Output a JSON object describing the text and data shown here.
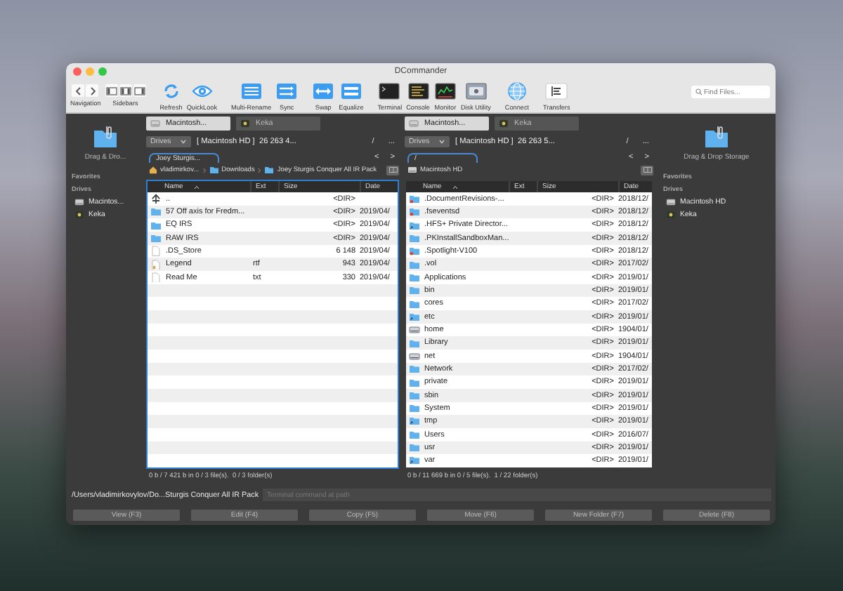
{
  "window": {
    "title": "DCommander"
  },
  "toolbar": [
    [
      {
        "kind": "segmented-nav",
        "label": "Navigation"
      },
      {
        "kind": "segmented-sidebars",
        "label": "Sidebars"
      }
    ],
    [
      {
        "kind": "refresh",
        "label": "Refresh"
      },
      {
        "kind": "quicklook",
        "label": "QuickLook"
      }
    ],
    [
      {
        "kind": "multi-rename",
        "label": "Multi-Rename"
      },
      {
        "kind": "sync",
        "label": "Sync"
      }
    ],
    [
      {
        "kind": "swap",
        "label": "Swap"
      },
      {
        "kind": "equalize",
        "label": "Equalize"
      }
    ],
    [
      {
        "kind": "terminal",
        "label": "Terminal"
      },
      {
        "kind": "console",
        "label": "Console"
      },
      {
        "kind": "monitor",
        "label": "Monitor"
      },
      {
        "kind": "disk-utility",
        "label": "Disk Utility"
      }
    ],
    [
      {
        "kind": "connect",
        "label": "Connect"
      }
    ],
    [
      {
        "kind": "transfers",
        "label": "Transfers"
      }
    ]
  ],
  "search": {
    "placeholder": "Find Files..."
  },
  "sidebars": [
    {
      "drop_label": "Drag & Dro...",
      "favorites_label": "Favorites",
      "drives_label": "Drives",
      "drives": [
        {
          "name": "Macintos...",
          "kind": "hd"
        },
        {
          "name": "Keka",
          "kind": "app"
        }
      ]
    },
    {
      "drop_label": "Drag & Drop Storage",
      "favorites_label": "Favorites",
      "drives_label": "Drives",
      "drives": [
        {
          "name": "Macintosh HD",
          "kind": "hd"
        },
        {
          "name": "Keka",
          "kind": "app"
        }
      ]
    }
  ],
  "panels": [
    {
      "active": true,
      "drive_tabs": [
        {
          "label": "Macintosh...",
          "kind": "hd",
          "selected": true
        },
        {
          "label": "Keka",
          "kind": "app",
          "selected": false
        }
      ],
      "drive_menu": "Drives",
      "drive_info": "[ Macintosh HD ]  26 263 4...",
      "root": "/",
      "more": "...",
      "path_tabs": [
        {
          "label": "Joey Sturgis...",
          "selected": true
        }
      ],
      "back": "<",
      "forward": ">",
      "breadcrumb": [
        {
          "kind": "home",
          "label": "vladimirkov..."
        },
        {
          "kind": "folder",
          "label": "Downloads"
        },
        {
          "kind": "folder",
          "label": "Joey Sturgis Conquer All IR Pack"
        }
      ],
      "columns": [
        "Name",
        "Ext",
        "Size",
        "Date"
      ],
      "rows": [
        {
          "kind": "up",
          "name": "..",
          "size": "<DIR>"
        },
        {
          "kind": "folder",
          "name": "57 Off axis for Fredm...",
          "size": "<DIR>",
          "date": "2019/04/"
        },
        {
          "kind": "folder",
          "name": "EQ IRS",
          "size": "<DIR>",
          "date": "2019/04/"
        },
        {
          "kind": "folder",
          "name": "RAW IRS",
          "size": "<DIR>",
          "date": "2019/04/"
        },
        {
          "kind": "file",
          "name": ".DS_Store",
          "size": "6 148",
          "date": "2019/04/"
        },
        {
          "kind": "doc",
          "name": "Legend",
          "ext": "rtf",
          "size": "943",
          "date": "2019/04/"
        },
        {
          "kind": "file",
          "name": "Read Me",
          "ext": "txt",
          "size": "330",
          "date": "2019/04/"
        }
      ],
      "status": "0 b / 7 421 b in 0 / 3 file(s).  0 / 3 folder(s)"
    },
    {
      "active": false,
      "drive_tabs": [
        {
          "label": "Macintosh...",
          "kind": "hd",
          "selected": true
        },
        {
          "label": "Keka",
          "kind": "app",
          "selected": false
        }
      ],
      "drive_menu": "Drives",
      "drive_info": "[ Macintosh HD ]  26 263 5...",
      "root": "/",
      "more": "...",
      "path_tabs": [
        {
          "label": "/",
          "selected": true
        }
      ],
      "back": "<",
      "forward": ">",
      "breadcrumb": [
        {
          "kind": "disk",
          "label": "Macintosh HD"
        }
      ],
      "columns": [
        "Name",
        "Ext",
        "Size",
        "Date"
      ],
      "rows": [
        {
          "kind": "folder-restricted",
          "name": ".DocumentRevisions-...",
          "size": "<DIR>",
          "date": "2018/12/"
        },
        {
          "kind": "folder-restricted",
          "name": ".fseventsd",
          "size": "<DIR>",
          "date": "2018/12/"
        },
        {
          "kind": "folder-link",
          "name": ".HFS+ Private Director...",
          "size": "<DIR>",
          "date": "2018/12/"
        },
        {
          "kind": "folder",
          "name": ".PKInstallSandboxMan...",
          "size": "<DIR>",
          "date": "2018/12/"
        },
        {
          "kind": "folder-restricted",
          "name": ".Spotlight-V100",
          "size": "<DIR>",
          "date": "2018/12/"
        },
        {
          "kind": "folder",
          "name": ".vol",
          "size": "<DIR>",
          "date": "2017/02/"
        },
        {
          "kind": "folder",
          "name": "Applications",
          "size": "<DIR>",
          "date": "2019/01/"
        },
        {
          "kind": "folder",
          "name": "bin",
          "size": "<DIR>",
          "date": "2019/01/"
        },
        {
          "kind": "folder",
          "name": "cores",
          "size": "<DIR>",
          "date": "2017/02/"
        },
        {
          "kind": "folder-link",
          "name": "etc",
          "size": "<DIR>",
          "date": "2019/01/"
        },
        {
          "kind": "disk",
          "name": "home",
          "size": "<DIR>",
          "date": "1904/01/"
        },
        {
          "kind": "folder",
          "name": "Library",
          "size": "<DIR>",
          "date": "2019/01/"
        },
        {
          "kind": "disk",
          "name": "net",
          "size": "<DIR>",
          "date": "1904/01/"
        },
        {
          "kind": "folder",
          "name": "Network",
          "size": "<DIR>",
          "date": "2017/02/"
        },
        {
          "kind": "folder",
          "name": "private",
          "size": "<DIR>",
          "date": "2019/01/"
        },
        {
          "kind": "folder",
          "name": "sbin",
          "size": "<DIR>",
          "date": "2019/01/"
        },
        {
          "kind": "folder",
          "name": "System",
          "size": "<DIR>",
          "date": "2019/01/"
        },
        {
          "kind": "folder-link",
          "name": "tmp",
          "size": "<DIR>",
          "date": "2019/01/"
        },
        {
          "kind": "folder",
          "name": "Users",
          "size": "<DIR>",
          "date": "2016/07/"
        },
        {
          "kind": "folder",
          "name": "usr",
          "size": "<DIR>",
          "date": "2019/01/"
        },
        {
          "kind": "folder-link",
          "name": "var",
          "size": "<DIR>",
          "date": "2019/01/"
        }
      ],
      "status": "0 b / 11 669 b in 0 / 5 file(s).  1 / 22 folder(s)"
    }
  ],
  "command": {
    "path": "/Users/vladimirkovylov/Do...Sturgis Conquer All IR Pack",
    "placeholder": "Terminal command at path"
  },
  "buttons": [
    "View (F3)",
    "Edit (F4)",
    "Copy (F5)",
    "Move (F6)",
    "New Folder (F7)",
    "Delete (F8)"
  ]
}
